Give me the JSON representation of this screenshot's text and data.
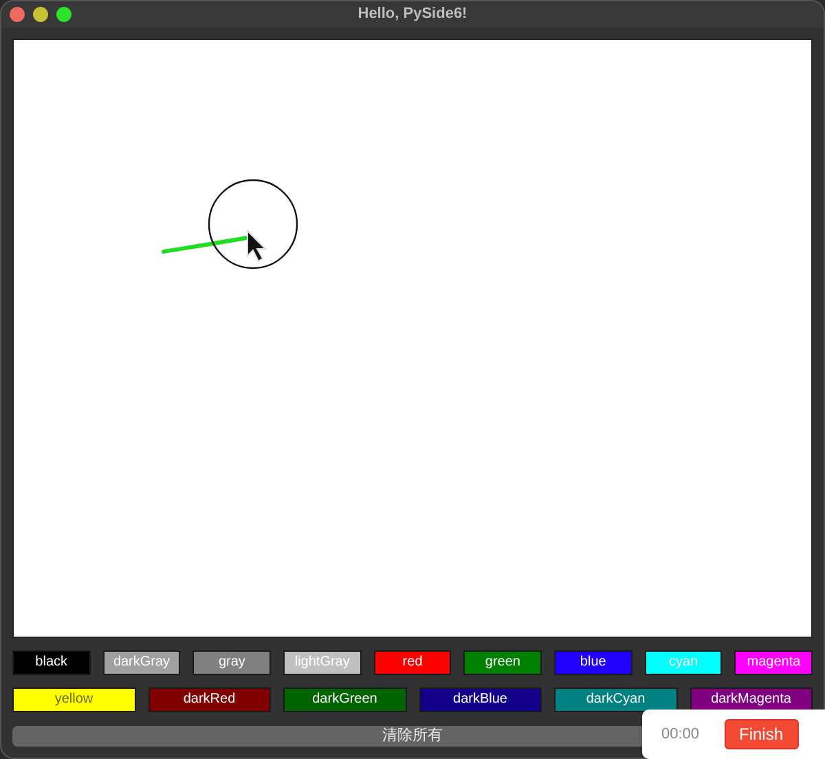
{
  "window": {
    "title": "Hello, PySide6!"
  },
  "color_buttons": [
    [
      {
        "label": "black",
        "color": "#000000"
      },
      {
        "label": "darkGray",
        "color": "#a0a0a0"
      },
      {
        "label": "gray",
        "color": "#808080"
      },
      {
        "label": "lightGray",
        "color": "#c0c0c0"
      },
      {
        "label": "red",
        "color": "#ff0000"
      },
      {
        "label": "green",
        "color": "#008000"
      },
      {
        "label": "blue",
        "color": "#2200ff"
      },
      {
        "label": "cyan",
        "color": "#00ffff"
      },
      {
        "label": "magenta",
        "color": "#ff00ff"
      }
    ],
    [
      {
        "label": "yellow",
        "color": "#ffff00"
      },
      {
        "label": "darkRed",
        "color": "#800000"
      },
      {
        "label": "darkGreen",
        "color": "#006400"
      },
      {
        "label": "darkBlue",
        "color": "#12008a"
      },
      {
        "label": "darkCyan",
        "color": "#008080"
      },
      {
        "label": "darkMagenta",
        "color": "#800080"
      }
    ]
  ],
  "clear_button": "清除所有",
  "recorder": {
    "time": "00:00",
    "button": "Finish"
  }
}
